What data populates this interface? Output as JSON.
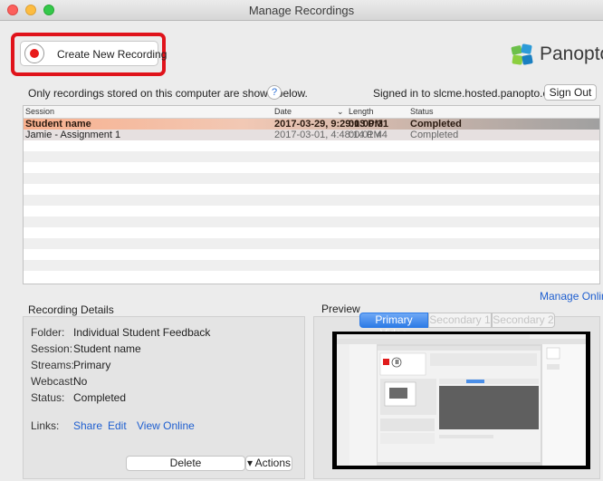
{
  "window": {
    "title": "Manage Recordings"
  },
  "toolbar": {
    "create_label": "Create New Recording"
  },
  "brand": {
    "name": "Panopto"
  },
  "info": {
    "stored_notice": "Only recordings stored on this computer are shown below.",
    "help_glyph": "?",
    "signed_in": "Signed in to slcme.hosted.panopto.com",
    "sign_out": "Sign Out"
  },
  "table": {
    "columns": {
      "session": "Session",
      "date": "Date",
      "date_sort": "⌄",
      "length": "Length",
      "status": "Status"
    },
    "rows": [
      {
        "session": "Student name",
        "date": "2017-03-29, 9:29:13 PM",
        "length": "00:00:31",
        "status": "Completed"
      },
      {
        "session": "Jamie - Assignment 1",
        "date": "2017-03-01, 4:48:14 PM",
        "length": "00:01:44",
        "status": "Completed"
      }
    ]
  },
  "details": {
    "heading": "Recording Details",
    "folder_label": "Folder:",
    "folder": "Individual Student Feedback",
    "session_label": "Session:",
    "session": "Student name",
    "streams_label": "Streams:",
    "streams": "Primary",
    "webcast_label": "Webcast:",
    "webcast": "No",
    "status_label": "Status:",
    "status": "Completed",
    "links_label": "Links:",
    "share": "Share",
    "edit": "Edit",
    "view_online": "View Online",
    "delete": "Delete",
    "actions": "▾ Actions"
  },
  "preview": {
    "heading": "Preview",
    "manage_online": "Manage Online",
    "tabs": [
      "Primary Video",
      "Secondary 1",
      "Secondary 2"
    ]
  },
  "colors": {
    "accent": "#e0131b",
    "link": "#1f5fd0",
    "selected_row": "#f8b08e"
  }
}
